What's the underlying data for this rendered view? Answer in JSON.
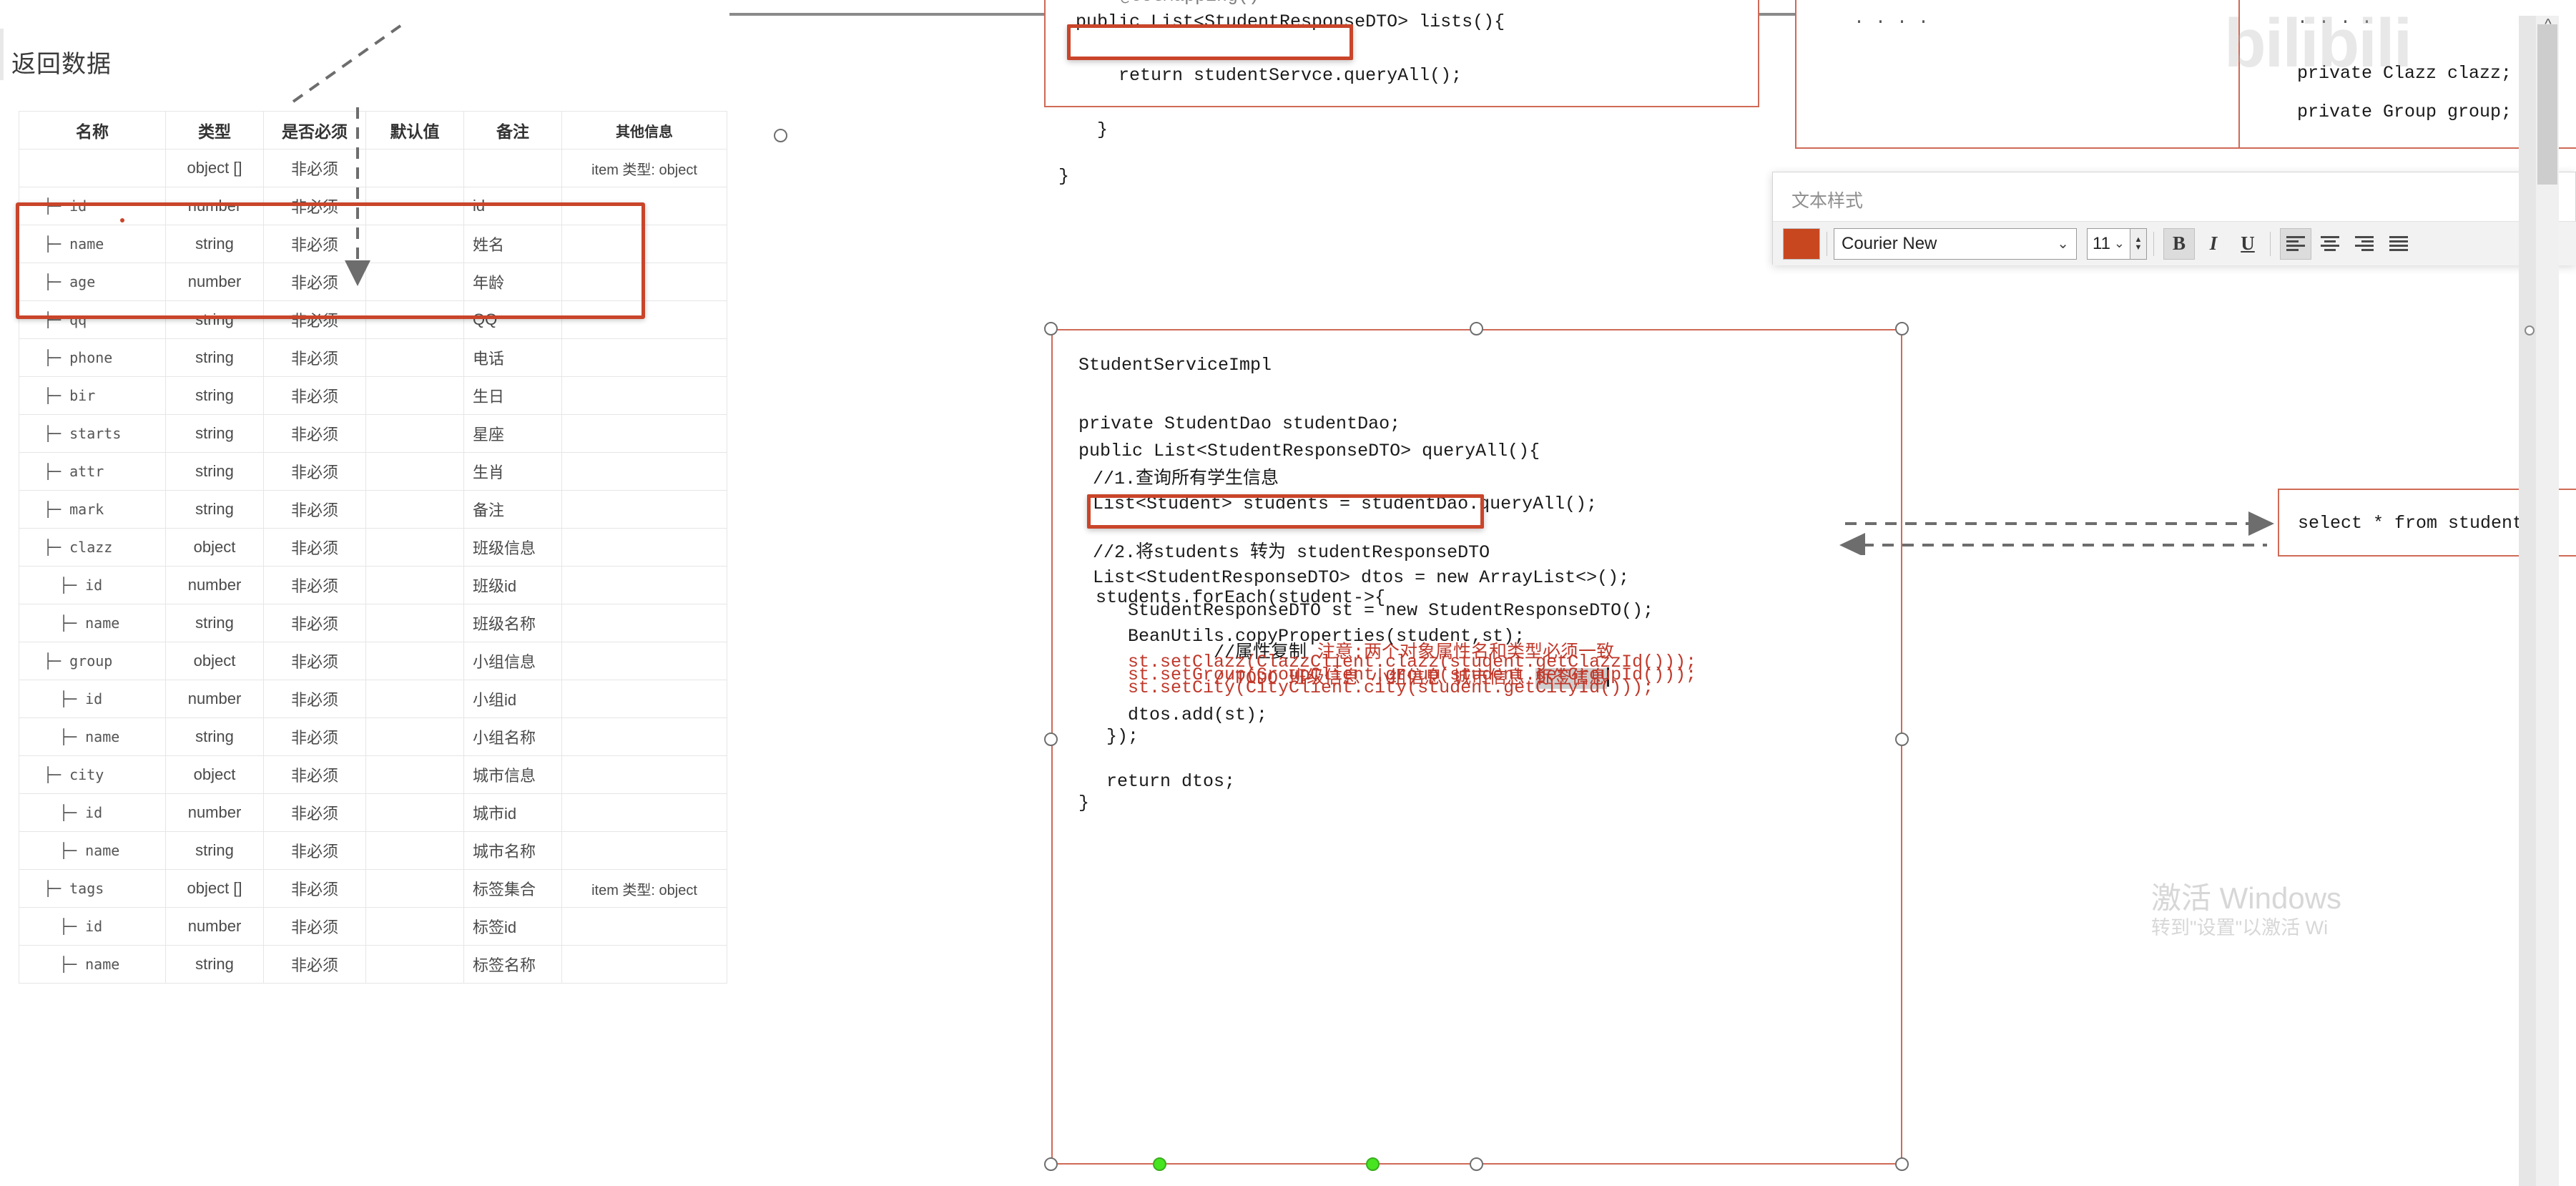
{
  "document": {
    "heading": "返回数据",
    "table": {
      "headers": [
        "名称",
        "类型",
        "是否必须",
        "默认值",
        "备注",
        "其他信息"
      ],
      "rows": [
        {
          "name": "",
          "type": "object []",
          "required": "非必须",
          "default": "",
          "mark": "",
          "other": "item 类型: object",
          "indent": 0
        },
        {
          "name": "├─ id",
          "type": "number",
          "required": "非必须",
          "default": "",
          "mark": "id",
          "other": "",
          "indent": 1
        },
        {
          "name": "├─ name",
          "type": "string",
          "required": "非必须",
          "default": "",
          "mark": "姓名",
          "other": "",
          "indent": 1
        },
        {
          "name": "├─ age",
          "type": "number",
          "required": "非必须",
          "default": "",
          "mark": "年龄",
          "other": "",
          "indent": 1
        },
        {
          "name": "├─ qq",
          "type": "string",
          "required": "非必须",
          "default": "",
          "mark": "QQ",
          "other": "",
          "indent": 1
        },
        {
          "name": "├─ phone",
          "type": "string",
          "required": "非必须",
          "default": "",
          "mark": "电话",
          "other": "",
          "indent": 1
        },
        {
          "name": "├─ bir",
          "type": "string",
          "required": "非必须",
          "default": "",
          "mark": "生日",
          "other": "",
          "indent": 1
        },
        {
          "name": "├─ starts",
          "type": "string",
          "required": "非必须",
          "default": "",
          "mark": "星座",
          "other": "",
          "indent": 1
        },
        {
          "name": "├─ attr",
          "type": "string",
          "required": "非必须",
          "default": "",
          "mark": "生肖",
          "other": "",
          "indent": 1
        },
        {
          "name": "├─ mark",
          "type": "string",
          "required": "非必须",
          "default": "",
          "mark": "备注",
          "other": "",
          "indent": 1
        },
        {
          "name": "├─ clazz",
          "type": "object",
          "required": "非必须",
          "default": "",
          "mark": "班级信息",
          "other": "",
          "indent": 1
        },
        {
          "name": "├─ id",
          "type": "number",
          "required": "非必须",
          "default": "",
          "mark": "班级id",
          "other": "",
          "indent": 2
        },
        {
          "name": "├─ name",
          "type": "string",
          "required": "非必须",
          "default": "",
          "mark": "班级名称",
          "other": "",
          "indent": 2
        },
        {
          "name": "├─ group",
          "type": "object",
          "required": "非必须",
          "default": "",
          "mark": "小组信息",
          "other": "",
          "indent": 1
        },
        {
          "name": "├─ id",
          "type": "number",
          "required": "非必须",
          "default": "",
          "mark": "小组id",
          "other": "",
          "indent": 2
        },
        {
          "name": "├─ name",
          "type": "string",
          "required": "非必须",
          "default": "",
          "mark": "小组名称",
          "other": "",
          "indent": 2
        },
        {
          "name": "├─ city",
          "type": "object",
          "required": "非必须",
          "default": "",
          "mark": "城市信息",
          "other": "",
          "indent": 1
        },
        {
          "name": "├─ id",
          "type": "number",
          "required": "非必须",
          "default": "",
          "mark": "城市id",
          "other": "",
          "indent": 2
        },
        {
          "name": "├─ name",
          "type": "string",
          "required": "非必须",
          "default": "",
          "mark": "城市名称",
          "other": "",
          "indent": 2
        },
        {
          "name": "├─ tags",
          "type": "object []",
          "required": "非必须",
          "default": "",
          "mark": "标签集合",
          "other": "item 类型: object",
          "indent": 1
        },
        {
          "name": "├─ id",
          "type": "number",
          "required": "非必须",
          "default": "",
          "mark": "标签id",
          "other": "",
          "indent": 2
        },
        {
          "name": "├─ name",
          "type": "string",
          "required": "非必须",
          "default": "",
          "mark": "标签名称",
          "other": "",
          "indent": 2
        }
      ]
    }
  },
  "diagram": {
    "controller_box": {
      "line_top_cut": "@GetMapping()",
      "line_signature": "public List<StudentResponseDTO> lists(){",
      "line_return": "    return studentServce.queryAll();",
      "line_close_inner": "  }",
      "line_close_outer": "}"
    },
    "main_box": {
      "title": "StudentServiceImpl",
      "field": "private StudentDao studentDao;",
      "method": "public List<StudentResponseDTO> queryAll(){",
      "comment1": "//1.查询所有学生信息",
      "stmt_highlighted": "List<Student> students = studentDao.queryAll();",
      "comment2": "//2.将students 转为 studentResponseDTO",
      "stmt_dtos": "List<StudentResponseDTO> dtos = new ArrayList<>();",
      "foreach_open": "students.forEach(student->{",
      "new_dto": "   StudentResponseDTO st = new StudentResponseDTO();",
      "comment_copy_black": "   //属性复制 ",
      "comment_copy_red": "注意:两个对象属性名和类型必须一致",
      "copy_props": "   BeanUtils.copyProperties(student,st);",
      "todo_prefix": "   //TODO 班级信息 小组信息 城市信息 ",
      "todo_selected": "标签信息",
      "set_clazz": "   st.setClazz(ClazzClient.clazz(student.getClazzId()));",
      "set_group": "   st.setGroup(GroupClient.group(student.getGroupId()));",
      "set_city": "   st.setCity(CityClient.city(student.getCityId()));",
      "dtos_add": "   dtos.add(st);",
      "foreach_close": " });",
      "return_stmt": " return dtos;",
      "close_brace": "}"
    },
    "right_box_1": {
      "dots": "· · · ·"
    },
    "right_box_2": {
      "dots": "· · · ·",
      "field_clazz": "private Clazz clazz;",
      "field_group": "private Group group;"
    },
    "sql_box": {
      "sql": "select * from student"
    }
  },
  "text_style_dialog": {
    "title": "文本样式",
    "color_swatch": "#C8471F",
    "font_family_value": "Courier New",
    "font_size_value": "11",
    "bold_label": "B",
    "italic_label": "I",
    "underline_label": "U",
    "dropdown_caret": "⌄",
    "spinner_up": "▲",
    "spinner_down": "▼"
  },
  "watermarks": {
    "bilibili": "bilibili",
    "windows_line1": "激活 Windows",
    "windows_line2": "转到\"设置\"以激活 Wi"
  },
  "scrollbar": {
    "up_arrow": "^"
  }
}
